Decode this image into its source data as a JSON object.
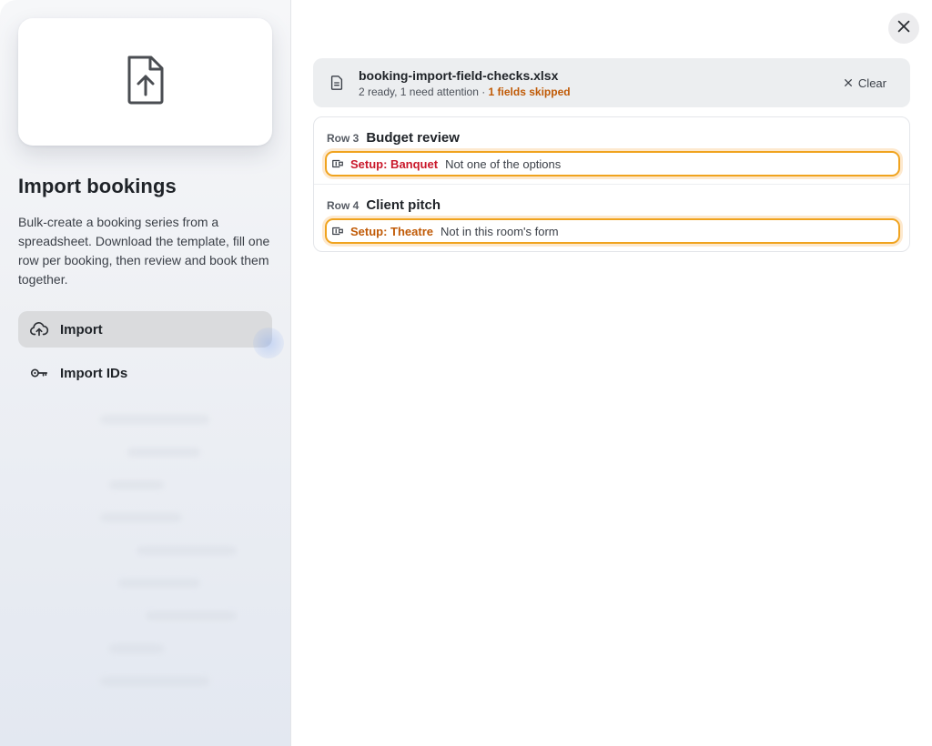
{
  "sidebar": {
    "title": "Import bookings",
    "description": "Bulk-create a booking series from a spreadsheet. Download the template, fill one row per booking, then review and book them together.",
    "nav": [
      {
        "label": "Import",
        "icon": "cloud-upload-icon",
        "active": true
      },
      {
        "label": "Import IDs",
        "icon": "key-icon",
        "active": false
      }
    ]
  },
  "file": {
    "name": "booking-import-field-checks.xlsx",
    "status_prefix": "2 ready, 1 need attention · ",
    "status_skipped": "1 fields skipped",
    "clear_label": "Clear"
  },
  "rows": [
    {
      "num": "Row 3",
      "title": "Budget review",
      "issue": {
        "field": "Setup: Banquet",
        "message": "Not one of the options",
        "color": "#c9182b"
      }
    },
    {
      "num": "Row 4",
      "title": "Client pitch",
      "issue": {
        "field": "Setup: Theatre",
        "message": "Not in this room's form",
        "color": "#c05a06"
      }
    }
  ],
  "colors": {
    "accent_warning": "#f0a31e",
    "error": "#c9182b",
    "warning_text": "#c05a06"
  }
}
